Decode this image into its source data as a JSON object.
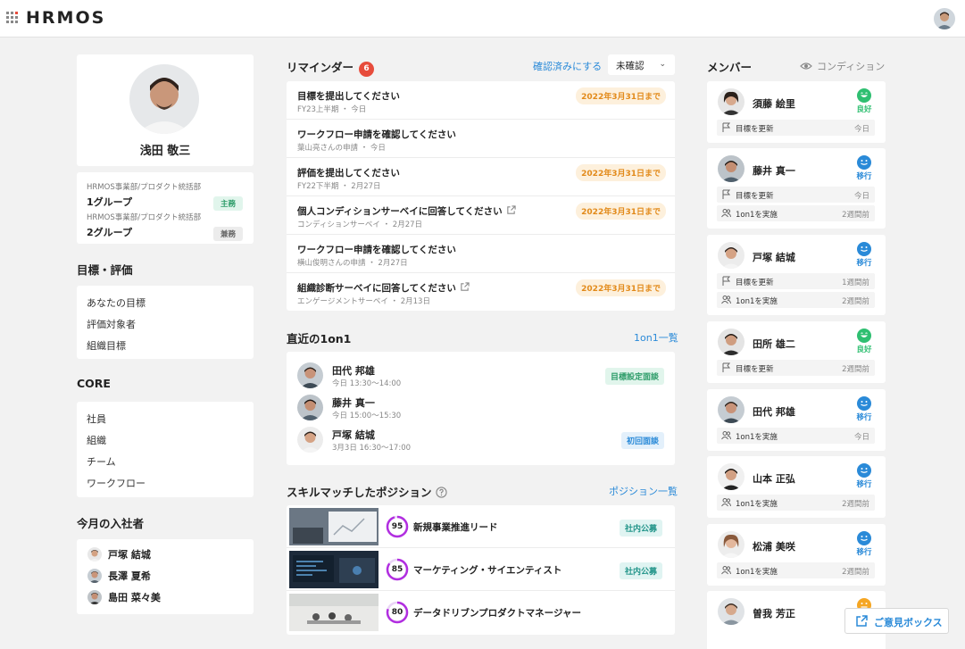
{
  "app": {
    "logo": "HRMOS"
  },
  "profile": {
    "name": "浅田 敬三",
    "groups": [
      {
        "dept": "HRMOS事業部/プロダクト統括部",
        "name": "1グループ",
        "badge": "主務"
      },
      {
        "dept": "HRMOS事業部/プロダクト統括部",
        "name": "2グループ",
        "badge": "兼務"
      }
    ]
  },
  "sections": {
    "goals": {
      "title": "目標・評価",
      "items": [
        "あなたの目標",
        "評価対象者",
        "組織目標"
      ]
    },
    "core": {
      "title": "CORE",
      "items": [
        "社員",
        "組織",
        "チーム",
        "ワークフロー"
      ]
    },
    "joiners": {
      "title": "今月の入社者",
      "items": [
        "戸塚 結城",
        "長澤 夏希",
        "島田 菜々美"
      ]
    }
  },
  "reminders": {
    "title": "リマインダー",
    "count": "6",
    "mark_all_link": "確認済みにする",
    "filter_value": "未確認",
    "items": [
      {
        "title": "目標を提出してください",
        "sub": "FY23上半期 ・ 今日",
        "deadline": "2022年3月31日まで"
      },
      {
        "title": "ワークフロー申請を確認してください",
        "sub": "葉山亮さんの申請 ・ 今日",
        "deadline": ""
      },
      {
        "title": "評価を提出してください",
        "sub": "FY22下半期 ・ 2月27日",
        "deadline": "2022年3月31日まで"
      },
      {
        "title": "個人コンディションサーベイに回答してください",
        "sub": "コンディションサーベイ ・ 2月27日",
        "deadline": "2022年3月31日まで"
      },
      {
        "title": "ワークフロー申請を確認してください",
        "sub": "横山俊明さんの申請 ・ 2月27日",
        "deadline": ""
      },
      {
        "title": "組織診断サーベイに回答してください",
        "sub": "エンゲージメントサーベイ ・ 2月13日",
        "deadline": "2022年3月31日まで"
      }
    ]
  },
  "oneonone": {
    "title": "直近の1on1",
    "list_link": "1on1一覧",
    "items": [
      {
        "name": "田代 邦雄",
        "time": "今日 13:30〜14:00",
        "tag": "目標設定面談"
      },
      {
        "name": "藤井 真一",
        "time": "今日 15:00〜15:30",
        "tag": ""
      },
      {
        "name": "戸塚 結城",
        "time": "3月3日 16:30〜17:00",
        "tag": "初回面談"
      }
    ]
  },
  "positions": {
    "title": "スキルマッチしたポジション",
    "list_link": "ポジション一覧",
    "items": [
      {
        "score": "95",
        "title": "新規事業推進リード",
        "tag": "社内公募"
      },
      {
        "score": "85",
        "title": "マーケティング・サイエンティスト",
        "tag": "社内公募"
      },
      {
        "score": "80",
        "title": "データドリブンプロダクトマネージャー",
        "tag": ""
      }
    ]
  },
  "members": {
    "title": "メンバー",
    "condition_link": "コンディション",
    "items": [
      {
        "name": "須藤 絵里",
        "condition": "良好",
        "acts": [
          {
            "label": "目標を更新",
            "time": "今日"
          }
        ]
      },
      {
        "name": "藤井 真一",
        "condition": "移行",
        "acts": [
          {
            "label": "目標を更新",
            "time": "今日"
          },
          {
            "label": "1on1を実施",
            "time": "2週間前"
          }
        ]
      },
      {
        "name": "戸塚 結城",
        "condition": "移行",
        "acts": [
          {
            "label": "目標を更新",
            "time": "1週間前"
          },
          {
            "label": "1on1を実施",
            "time": "2週間前"
          }
        ]
      },
      {
        "name": "田所 雄二",
        "condition": "良好",
        "acts": [
          {
            "label": "目標を更新",
            "time": "2週間前"
          }
        ]
      },
      {
        "name": "田代 邦雄",
        "condition": "移行",
        "acts": [
          {
            "label": "1on1を実施",
            "time": "今日"
          }
        ]
      },
      {
        "name": "山本 正弘",
        "condition": "移行",
        "acts": [
          {
            "label": "1on1を実施",
            "time": "2週間前"
          }
        ]
      },
      {
        "name": "松浦 美咲",
        "condition": "移行",
        "acts": [
          {
            "label": "1on1を実施",
            "time": "2週間前"
          }
        ]
      },
      {
        "name": "曽我 芳正",
        "condition": "",
        "acts": []
      }
    ]
  },
  "feedback": {
    "label": "ご意見ボックス"
  },
  "colors": {
    "accent": "#2a8ad8",
    "good": "#2fbf71",
    "transition": "#2a8ad8",
    "deadline": "#e28a1a",
    "badge_red": "#e74c3c",
    "score_ring": "#b12ee0"
  }
}
